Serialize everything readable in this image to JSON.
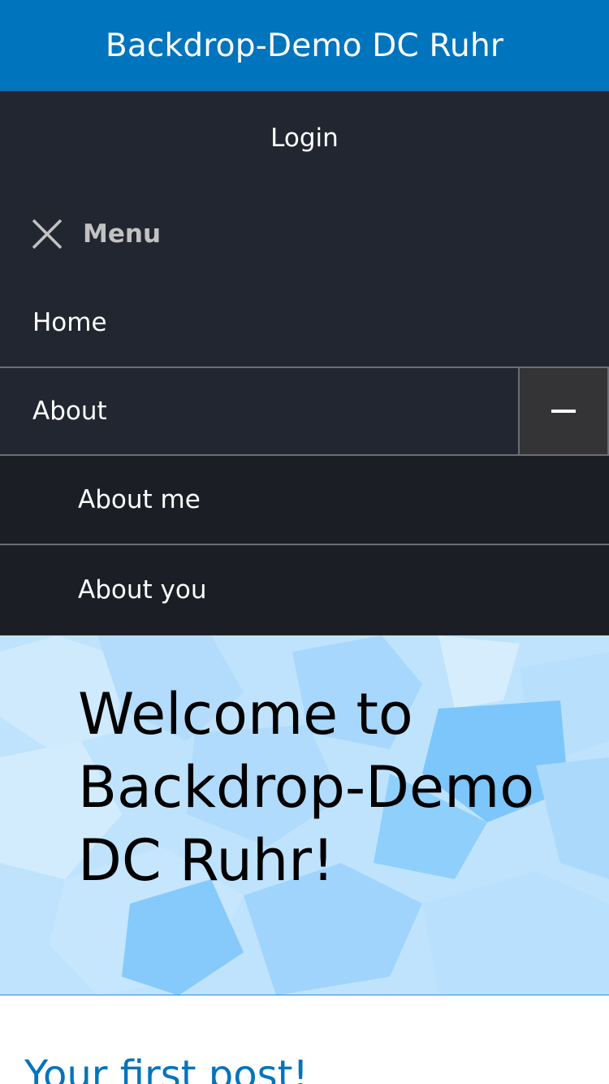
{
  "header": {
    "site_name": "Backdrop-Demo DC Ruhr"
  },
  "nav": {
    "login_label": "Login",
    "menu_label": "Menu",
    "items": [
      {
        "label": "Home"
      },
      {
        "label": "About"
      }
    ],
    "about_submenu": [
      {
        "label": "About me"
      },
      {
        "label": "About you"
      }
    ]
  },
  "hero": {
    "title": "Welcome to Backdrop-Demo DC Ruhr!"
  },
  "content": {
    "post_title": "Your first post!"
  },
  "colors": {
    "brand_blue": "#0074bd",
    "nav_bg": "#222630",
    "submenu_bg": "#1b1e25",
    "hero_bg": "#bfe3fd"
  }
}
